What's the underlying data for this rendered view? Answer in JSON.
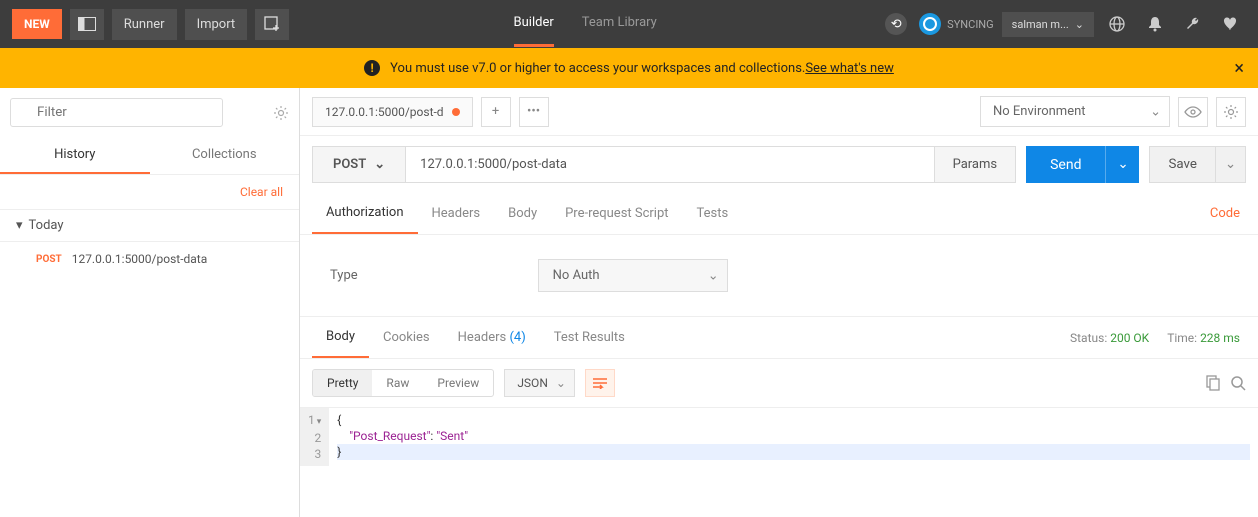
{
  "topbar": {
    "new": "NEW",
    "runner": "Runner",
    "import": "Import",
    "tabs": {
      "builder": "Builder",
      "team": "Team Library"
    },
    "sync_label": "SYNCING",
    "user": "salman m..."
  },
  "warning": {
    "text": "You must use v7.0 or higher to access your workspaces and collections. ",
    "link": "See what's new"
  },
  "sidebar": {
    "filter_placeholder": "Filter",
    "tabs": {
      "history": "History",
      "collections": "Collections"
    },
    "clear": "Clear all",
    "group": "Today",
    "items": [
      {
        "method": "POST",
        "url": "127.0.0.1:5000/post-data"
      }
    ]
  },
  "request": {
    "tab_label": "127.0.0.1:5000/post-d",
    "env": "No Environment",
    "method": "POST",
    "url": "127.0.0.1:5000/post-data",
    "params": "Params",
    "send": "Send",
    "save": "Save",
    "tabs": {
      "authorization": "Authorization",
      "headers": "Headers",
      "body": "Body",
      "prerequest": "Pre-request Script",
      "tests": "Tests"
    },
    "code_link": "Code",
    "auth": {
      "type_label": "Type",
      "value": "No Auth"
    }
  },
  "response": {
    "tabs": {
      "body": "Body",
      "cookies": "Cookies",
      "headers": "Headers",
      "headers_count": "(4)",
      "tests": "Test Results"
    },
    "status_k": "Status:",
    "status_v": "200 OK",
    "time_k": "Time:",
    "time_v": "228 ms",
    "fmt": {
      "pretty": "Pretty",
      "raw": "Raw",
      "preview": "Preview",
      "json": "JSON"
    },
    "lines": [
      "1",
      "2",
      "3"
    ],
    "code": {
      "l1": "{",
      "l2_key": "\"Post_Request\"",
      "l2_sep": ": ",
      "l2_val": "\"Sent\"",
      "l3": "}"
    }
  }
}
